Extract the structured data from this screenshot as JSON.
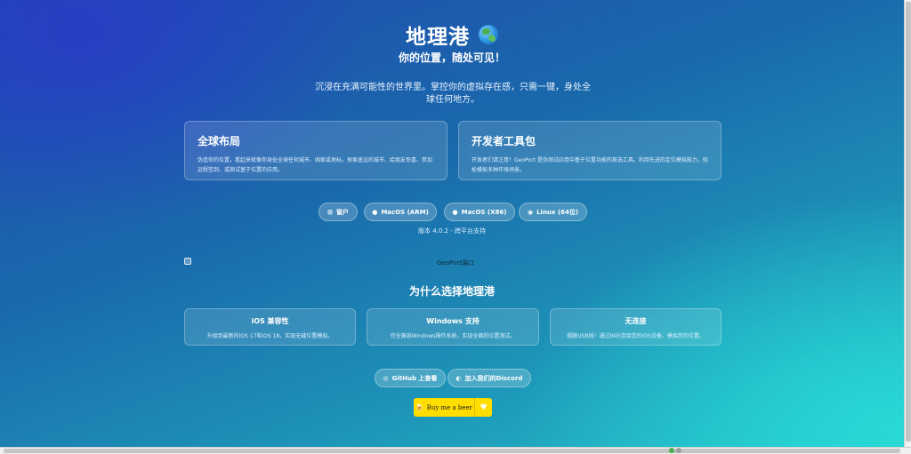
{
  "header": {
    "title": "地理港",
    "globe_icon": "globe-icon",
    "subtitle": "你的位置，随处可见！"
  },
  "description": "沉浸在充满可能性的世界里。掌控你的虚拟存在感，只需一键，身处全球任何地方。",
  "features": [
    {
      "title": "全球布局",
      "text": "伪造你的位置，看起来就像你身处全球任何城市、国家或地标。探索遥远的城市、给朋友惊喜、参加远程签到、或测试基于位置的应用。"
    },
    {
      "title": "开发者工具包",
      "text": "开发者们请注意！GeoPort 是伪测试应用中基于位置功能的首选工具。利用先进的定位模拟能力，轻松模拟多种环境场景。"
    }
  ],
  "downloads": [
    {
      "label": "窗户",
      "icon": "windows-icon"
    },
    {
      "label": "MacOS (ARM)",
      "icon": "apple-icon"
    },
    {
      "label": "MacOS (X86)",
      "icon": "apple-icon"
    },
    {
      "label": "Linux (64位)",
      "icon": "linux-icon"
    }
  ],
  "version": "版本 4.0.2 - 跨平台支持",
  "image_alt": "GeoPort端口",
  "why": {
    "title": "为什么选择地理港",
    "items": [
      {
        "title": "iOS 兼容性",
        "text": "升级到最新的iOS 17和iOS 18，实现无缝位置模拟。"
      },
      {
        "title": "Windows 支持",
        "text": "完全兼容Windows操作系统，实现全面的位置测试。"
      },
      {
        "title": "无连接",
        "text": "摆脱USB线！通过WiFi连接您的iOS设备，模拟您的位置。"
      }
    ]
  },
  "social": [
    {
      "label": "GitHub 上查看",
      "icon": "github-icon"
    },
    {
      "label": "加入我们的Discord",
      "icon": "discord-icon"
    }
  ],
  "coffee": {
    "label": "Buy me a beer",
    "icon": "beer-icon"
  },
  "colors": {
    "coffee_bg": "#ffdd00",
    "bg_top": "#1f48b0",
    "bg_bottom": "#26c3c9"
  }
}
